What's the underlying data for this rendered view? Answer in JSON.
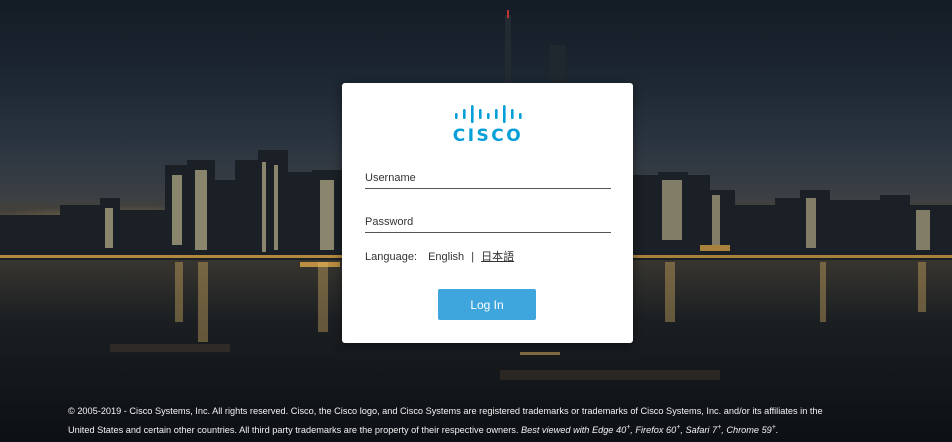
{
  "brand": {
    "logo_text": "CISCO",
    "accent_color": "#049fd9"
  },
  "login": {
    "username_placeholder": "Username",
    "password_placeholder": "Password",
    "language_label": "Language:",
    "language_current": "English",
    "language_separator": "|",
    "language_alternate": "日本語",
    "login_button": "Log In",
    "button_color": "#3fa6dd"
  },
  "footer": {
    "copyright": "© 2005-2019 - Cisco Systems, Inc. All rights reserved. Cisco, the Cisco logo, and Cisco Systems are registered trademarks or trademarks of Cisco Systems, Inc. and/or its affiliates in the",
    "copyright_cont": "United States and certain other countries. All third party trademarks are the property of their respective owners.",
    "best_viewed": "Best viewed with Edge 40",
    "browser_2": "Firefox 60",
    "browser_3": "Safari 7",
    "browser_4": "Chrome 59",
    "plus": "+"
  }
}
